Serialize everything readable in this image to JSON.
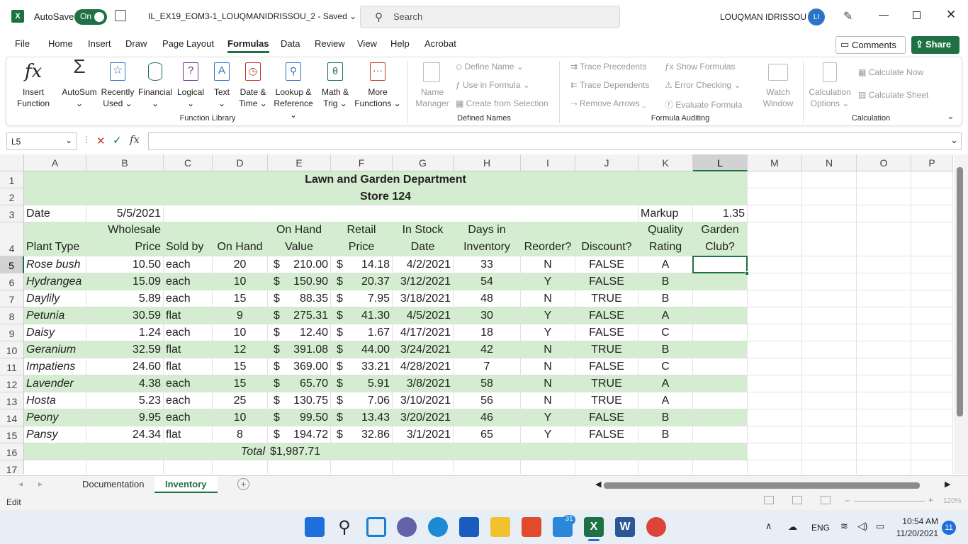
{
  "titlebar": {
    "autosave_label": "AutoSave",
    "autosave_state": "On",
    "doc_title": "IL_EX19_EOM3-1_LOUQMANIDRISSOU_2 - Saved",
    "search_placeholder": "Search",
    "user_name": "LOUQMAN IDRISSOU",
    "user_initials": "LI"
  },
  "menu": {
    "items": [
      "File",
      "Home",
      "Insert",
      "Draw",
      "Page Layout",
      "Formulas",
      "Data",
      "Review",
      "View",
      "Help",
      "Acrobat"
    ],
    "active": "Formulas",
    "comments": "Comments",
    "share": "Share"
  },
  "ribbon": {
    "function_library": {
      "group_label": "Function Library",
      "insert_function": [
        "Insert",
        "Function"
      ],
      "buttons": [
        {
          "l1": "AutoSum",
          "l2": "⌄"
        },
        {
          "l1": "Recently",
          "l2": "Used ⌄"
        },
        {
          "l1": "Financial",
          "l2": "⌄"
        },
        {
          "l1": "Logical",
          "l2": "⌄"
        },
        {
          "l1": "Text",
          "l2": "⌄"
        },
        {
          "l1": "Date &",
          "l2": "Time ⌄"
        },
        {
          "l1": "Lookup &",
          "l2": "Reference ⌄"
        },
        {
          "l1": "Math &",
          "l2": "Trig ⌄"
        },
        {
          "l1": "More",
          "l2": "Functions ⌄"
        }
      ]
    },
    "defined_names": {
      "group_label": "Defined Names",
      "name_manager": [
        "Name",
        "Manager"
      ],
      "define_name": "Define Name ⌄",
      "use_in_formula": "Use in Formula ⌄",
      "create_from_selection": "Create from Selection"
    },
    "formula_auditing": {
      "group_label": "Formula Auditing",
      "trace_precedents": "Trace Precedents",
      "trace_dependents": "Trace Dependents",
      "remove_arrows": "Remove Arrows ⌄",
      "show_formulas": "Show Formulas",
      "error_checking": "Error Checking ⌄",
      "evaluate_formula": "Evaluate Formula",
      "watch_window": [
        "Watch",
        "Window"
      ]
    },
    "calculation": {
      "group_label": "Calculation",
      "calc_options": [
        "Calculation",
        "Options ⌄"
      ],
      "calculate_now": "Calculate Now",
      "calculate_sheet": "Calculate Sheet"
    }
  },
  "formula_bar": {
    "name_box": "L5",
    "content": ""
  },
  "grid": {
    "columns": [
      "A",
      "B",
      "C",
      "D",
      "E",
      "F",
      "G",
      "H",
      "I",
      "J",
      "K",
      "L",
      "M",
      "N",
      "O",
      "P"
    ],
    "rows": [
      "1",
      "2",
      "3",
      "4",
      "5",
      "6",
      "7",
      "8",
      "9",
      "10",
      "11",
      "12",
      "13",
      "14",
      "15",
      "16",
      "17"
    ],
    "selected_col": "L",
    "selected_row": "5",
    "title1": "Lawn and Garden Department",
    "title2": "Store 124",
    "date_label": "Date",
    "date_value": "5/5/2021",
    "markup_label": "Markup",
    "markup_value": "1.35",
    "headers_top": [
      "",
      "Wholesale",
      "",
      "",
      "On Hand",
      "Retail",
      "In Stock",
      "Days in",
      "",
      "",
      "Quality",
      "Garden"
    ],
    "headers_bottom": [
      "Plant Type",
      "Price",
      "Sold by",
      "On Hand",
      "Value",
      "Price",
      "Date",
      "Inventory",
      "Reorder?",
      "Discount?",
      "Rating",
      "Club?"
    ],
    "data": [
      [
        "Rose bush",
        "10.50",
        "each",
        "20",
        "$",
        "210.00",
        "$",
        "14.18",
        "4/2/2021",
        "33",
        "N",
        "FALSE",
        "A"
      ],
      [
        "Hydrangea",
        "15.09",
        "each",
        "10",
        "$",
        "150.90",
        "$",
        "20.37",
        "3/12/2021",
        "54",
        "Y",
        "FALSE",
        "B"
      ],
      [
        "Daylily",
        "5.89",
        "each",
        "15",
        "$",
        "88.35",
        "$",
        "7.95",
        "3/18/2021",
        "48",
        "N",
        "TRUE",
        "B"
      ],
      [
        "Petunia",
        "30.59",
        "flat",
        "9",
        "$",
        "275.31",
        "$",
        "41.30",
        "4/5/2021",
        "30",
        "Y",
        "FALSE",
        "A"
      ],
      [
        "Daisy",
        "1.24",
        "each",
        "10",
        "$",
        "12.40",
        "$",
        "1.67",
        "4/17/2021",
        "18",
        "Y",
        "FALSE",
        "C"
      ],
      [
        "Geranium",
        "32.59",
        "flat",
        "12",
        "$",
        "391.08",
        "$",
        "44.00",
        "3/24/2021",
        "42",
        "N",
        "TRUE",
        "B"
      ],
      [
        "Impatiens",
        "24.60",
        "flat",
        "15",
        "$",
        "369.00",
        "$",
        "33.21",
        "4/28/2021",
        "7",
        "N",
        "FALSE",
        "C"
      ],
      [
        "Lavender",
        "4.38",
        "each",
        "15",
        "$",
        "65.70",
        "$",
        "5.91",
        "3/8/2021",
        "58",
        "N",
        "TRUE",
        "A"
      ],
      [
        "Hosta",
        "5.23",
        "each",
        "25",
        "$",
        "130.75",
        "$",
        "7.06",
        "3/10/2021",
        "56",
        "N",
        "TRUE",
        "A"
      ],
      [
        "Peony",
        "9.95",
        "each",
        "10",
        "$",
        "99.50",
        "$",
        "13.43",
        "3/20/2021",
        "46",
        "Y",
        "FALSE",
        "B"
      ],
      [
        "Pansy",
        "24.34",
        "flat",
        "8",
        "$",
        "194.72",
        "$",
        "32.86",
        "3/1/2021",
        "65",
        "Y",
        "FALSE",
        "B"
      ]
    ],
    "total_label": "Total",
    "total_value": "$1,987.71"
  },
  "sheets": {
    "tabs": [
      "Documentation",
      "Inventory"
    ],
    "active": "Inventory"
  },
  "status": {
    "mode": "Edit",
    "zoom": "120%"
  },
  "taskbar": {
    "lang": "ENG",
    "time": "10:54 AM",
    "date": "11/20/2021",
    "mail_badge": "31",
    "notif": "11"
  },
  "colors": {
    "excel_green": "#1e7145",
    "band_green": "#d4eccf",
    "header_green": "#c6e4c0"
  }
}
